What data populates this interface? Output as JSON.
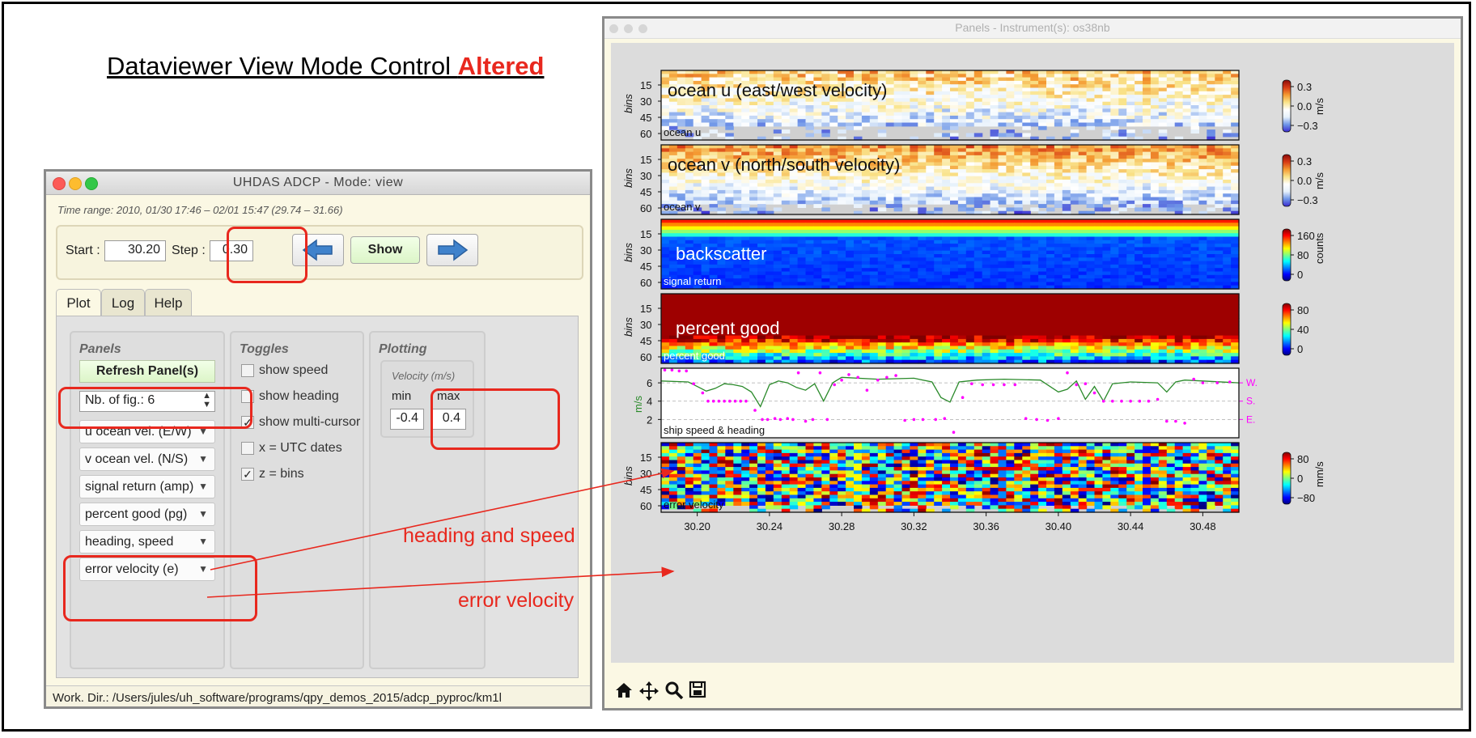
{
  "slide": {
    "title_main": "Dataviewer View Mode Control",
    "title_highlight": "Altered",
    "annotation_heading": "heading and speed",
    "annotation_error": "error velocity"
  },
  "left_window": {
    "title": "UHDAS ADCP - Mode: view",
    "time_range": "Time range: 2010, 01/30 17:46 – 02/01 15:47 (29.74 – 31.66)",
    "start_label": "Start :",
    "start_value": "30.20",
    "step_label": "Step :",
    "step_value": "0.30",
    "show_label": "Show",
    "tabs": [
      "Plot",
      "Log",
      "Help"
    ],
    "panels": {
      "title": "Panels",
      "refresh_label": "Refresh Panel(s)",
      "nb_fig": "Nb. of fig.: 6",
      "selects": [
        "u ocean vel. (E/W)",
        "v ocean vel. (N/S)",
        "signal return (amp)",
        "percent good (pg)",
        "heading, speed",
        "error velocity (e)"
      ]
    },
    "toggles": {
      "title": "Toggles",
      "items": [
        {
          "label": "show speed",
          "checked": false
        },
        {
          "label": "show heading",
          "checked": false
        },
        {
          "label": "show multi-cursor",
          "checked": true
        },
        {
          "label": "x = UTC dates",
          "checked": false
        },
        {
          "label": "z = bins",
          "checked": true
        }
      ]
    },
    "plotting": {
      "title": "Plotting",
      "velocity_label": "Velocity (m/s)",
      "min_label": "min",
      "max_label": "max",
      "min_value": "-0.4",
      "max_value": "0.4"
    },
    "status": "Work. Dir.: /Users/jules/uh_software/programs/qpy_demos_2015/adcp_pyproc/km1l"
  },
  "right_window": {
    "title": "Panels - Instrument(s): os38nb",
    "toolbar_icons": [
      "home-icon",
      "move-icon",
      "zoom-icon",
      "save-icon"
    ]
  },
  "chart_data": [
    {
      "type": "heatmap",
      "title": "ocean u (east/west velocity)",
      "corner_label": "ocean u",
      "ylabel": "bins",
      "yticks": [
        "15",
        "30",
        "45",
        "60"
      ],
      "colorbar_label": "m/s",
      "colorbar_ticks": [
        "0.3",
        "0.0",
        "−0.3"
      ],
      "colormap": [
        "#3b2bd0",
        "#6f97e8",
        "#e6f1fb",
        "#ffffff",
        "#f9e38a",
        "#f49a32",
        "#d73a15",
        "#8b0a0a"
      ]
    },
    {
      "type": "heatmap",
      "title": "ocean v (north/south velocity)",
      "corner_label": "ocean v",
      "ylabel": "bins",
      "yticks": [
        "15",
        "30",
        "45",
        "60"
      ],
      "colorbar_label": "m/s",
      "colorbar_ticks": [
        "0.3",
        "0.0",
        "−0.3"
      ],
      "colormap": [
        "#3b2bd0",
        "#6f97e8",
        "#e6f1fb",
        "#ffffff",
        "#f9e38a",
        "#f49a32",
        "#d73a15",
        "#8b0a0a"
      ]
    },
    {
      "type": "heatmap",
      "title": "backscatter",
      "corner_label": "signal return",
      "ylabel": "bins",
      "yticks": [
        "15",
        "30",
        "45",
        "60"
      ],
      "colorbar_label": "counts",
      "colorbar_ticks": [
        "160",
        "80",
        "0"
      ],
      "colormap": [
        "#00007f",
        "#0000ff",
        "#0080ff",
        "#00ffff",
        "#80ff80",
        "#ffff00",
        "#ff8000",
        "#ff0000",
        "#800000"
      ]
    },
    {
      "type": "heatmap",
      "title": "percent good",
      "corner_label": "percent good",
      "ylabel": "bins",
      "yticks": [
        "15",
        "30",
        "45",
        "60"
      ],
      "colorbar_label": "",
      "colorbar_ticks": [
        "80",
        "40",
        "0"
      ],
      "colormap": [
        "#00007f",
        "#0000ff",
        "#0080ff",
        "#00ffff",
        "#80ff80",
        "#ffff00",
        "#ff8000",
        "#ff0000",
        "#800000"
      ]
    },
    {
      "type": "line",
      "corner_label": "ship speed & heading",
      "ylabel": "m/s",
      "yticks": [
        "6",
        "4",
        "2"
      ],
      "ylim": [
        0,
        7.6
      ],
      "heading_labels": [
        "W.",
        "S.",
        "E."
      ],
      "speed_color": "#2a8a2a",
      "heading_color": "#ff00ff",
      "speed": {
        "x": [
          30.18,
          30.195,
          30.2,
          30.205,
          30.21,
          30.215,
          30.22,
          30.225,
          30.23,
          30.235,
          30.24,
          30.245,
          30.25,
          30.255,
          30.26,
          30.265,
          30.27,
          30.275,
          30.28,
          30.3,
          30.32,
          30.33,
          30.335,
          30.34,
          30.345,
          30.35,
          30.355,
          30.37,
          30.39,
          30.4,
          30.405,
          30.41,
          30.415,
          30.42,
          30.425,
          30.43,
          30.44,
          30.455,
          30.46,
          30.465,
          30.47,
          30.48,
          30.5
        ],
        "y": [
          6.2,
          6.1,
          5.6,
          5.1,
          5.4,
          5.9,
          5.8,
          5.6,
          5.0,
          3.4,
          5.8,
          6.2,
          6.0,
          5.5,
          5.2,
          5.9,
          4.0,
          6.0,
          6.6,
          6.4,
          6.5,
          6.1,
          4.4,
          3.9,
          6.1,
          6.2,
          6.3,
          6.4,
          6.3,
          5.0,
          5.3,
          6.2,
          4.2,
          5.6,
          4.0,
          5.9,
          6.1,
          6.0,
          5.0,
          6.1,
          6.3,
          6.2,
          6.0
        ]
      },
      "heading": {
        "x": [
          30.182,
          30.186,
          30.19,
          30.194,
          30.198,
          30.203,
          30.206,
          30.209,
          30.212,
          30.215,
          30.218,
          30.221,
          30.224,
          30.227,
          30.232,
          30.236,
          30.239,
          30.243,
          30.246,
          30.25,
          30.253,
          30.256,
          30.26,
          30.264,
          30.268,
          30.272,
          30.276,
          30.28,
          30.284,
          30.289,
          30.294,
          30.3,
          30.305,
          30.31,
          30.315,
          30.32,
          30.325,
          30.332,
          30.337,
          30.342,
          30.347,
          30.352,
          30.358,
          30.364,
          30.37,
          30.376,
          30.382,
          30.388,
          30.394,
          30.4,
          30.405,
          30.41,
          30.415,
          30.42,
          30.425,
          30.43,
          30.435,
          30.44,
          30.445,
          30.45,
          30.455,
          30.46,
          30.465,
          30.47,
          30.475,
          30.48,
          30.488,
          30.495
        ],
        "y": [
          7.4,
          7.4,
          7.3,
          7.3,
          5.9,
          4.9,
          4.0,
          4.0,
          4.0,
          4.0,
          4.0,
          4.0,
          4.0,
          4.0,
          3.0,
          2.0,
          2.0,
          2.1,
          2.0,
          2.1,
          2.0,
          7.1,
          1.8,
          2.0,
          7.1,
          2.0,
          5.8,
          6.3,
          6.9,
          6.6,
          5.2,
          6.3,
          6.6,
          6.8,
          1.9,
          2.0,
          2.0,
          2.0,
          2.1,
          0.6,
          4.4,
          5.9,
          5.8,
          5.8,
          5.8,
          5.8,
          2.1,
          2.0,
          1.9,
          2.1,
          7.1,
          5.8,
          5.9,
          4.9,
          4.0,
          4.0,
          4.0,
          4.0,
          4.0,
          4.0,
          4.2,
          1.8,
          1.8,
          1.6,
          6.4,
          6.0,
          6.0,
          6.1
        ]
      }
    },
    {
      "type": "heatmap",
      "title": "",
      "corner_label": "error velocity",
      "ylabel": "bins",
      "yticks": [
        "15",
        "30",
        "45",
        "60"
      ],
      "colorbar_label": "mm/s",
      "colorbar_ticks": [
        "80",
        "0",
        "−80"
      ],
      "colormap": [
        "#00007f",
        "#0000ff",
        "#0080ff",
        "#00ffff",
        "#80ff80",
        "#ffff00",
        "#ff8000",
        "#ff0000",
        "#800000"
      ]
    }
  ],
  "x_axis": {
    "ticks": [
      "30.20",
      "30.24",
      "30.28",
      "30.32",
      "30.36",
      "30.40",
      "30.44",
      "30.48"
    ],
    "values": [
      30.2,
      30.24,
      30.28,
      30.32,
      30.36,
      30.4,
      30.44,
      30.48
    ],
    "xlim": [
      30.18,
      30.5
    ]
  }
}
